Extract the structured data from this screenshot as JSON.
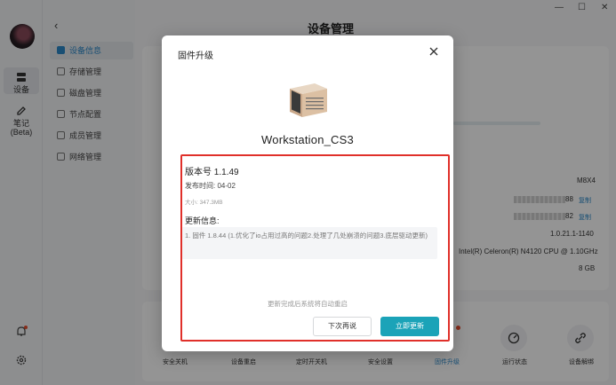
{
  "window": {
    "title": "设备管理",
    "minimize": "—",
    "maximize": "☐",
    "close": "✕"
  },
  "rail": {
    "items": [
      {
        "label": "设备",
        "icon": "device-icon"
      },
      {
        "label": "笔记",
        "sub": "(Beta)",
        "icon": "note-icon"
      }
    ]
  },
  "sidebar": {
    "back": "‹",
    "items": [
      {
        "label": "设备信息",
        "active": true
      },
      {
        "label": "存储管理"
      },
      {
        "label": "磁盘管理"
      },
      {
        "label": "节点配置"
      },
      {
        "label": "成员管理"
      },
      {
        "label": "网络管理"
      }
    ]
  },
  "device_info": {
    "model": "M8X4",
    "sn_suffix": "88",
    "mac_suffix": "82",
    "copy_label": "复制",
    "firmware": "1.0.21.1-1140",
    "cpu": "Intel(R) Celeron(R) N4120 CPU @ 1.10GHz",
    "memory": "8 GB"
  },
  "actions": [
    {
      "label": "安全关机"
    },
    {
      "label": "设备重启"
    },
    {
      "label": "定时开关机"
    },
    {
      "label": "安全设置"
    },
    {
      "label": "固件升级",
      "active": true
    },
    {
      "label": "运行状态"
    },
    {
      "label": "设备解绑"
    }
  ],
  "modal": {
    "title": "固件升级",
    "device_name": "Workstation_CS3",
    "version": "版本号 1.1.49",
    "release_date": "发布时间: 04-02",
    "size": "大小: 347.3MB",
    "update_heading": "更新信息:",
    "notes": "1. 固件 1.8.44 (1.优化了io占用过高的问题2.处理了几处崩溃的问题3.底层驱动更新)",
    "restart_hint": "更新完成后系统将自动重启",
    "later_button": "下次再说",
    "update_button": "立即更新"
  },
  "colors": {
    "accent": "#1ba3b8",
    "link": "#2b88c8",
    "highlight": "#e0302a"
  }
}
